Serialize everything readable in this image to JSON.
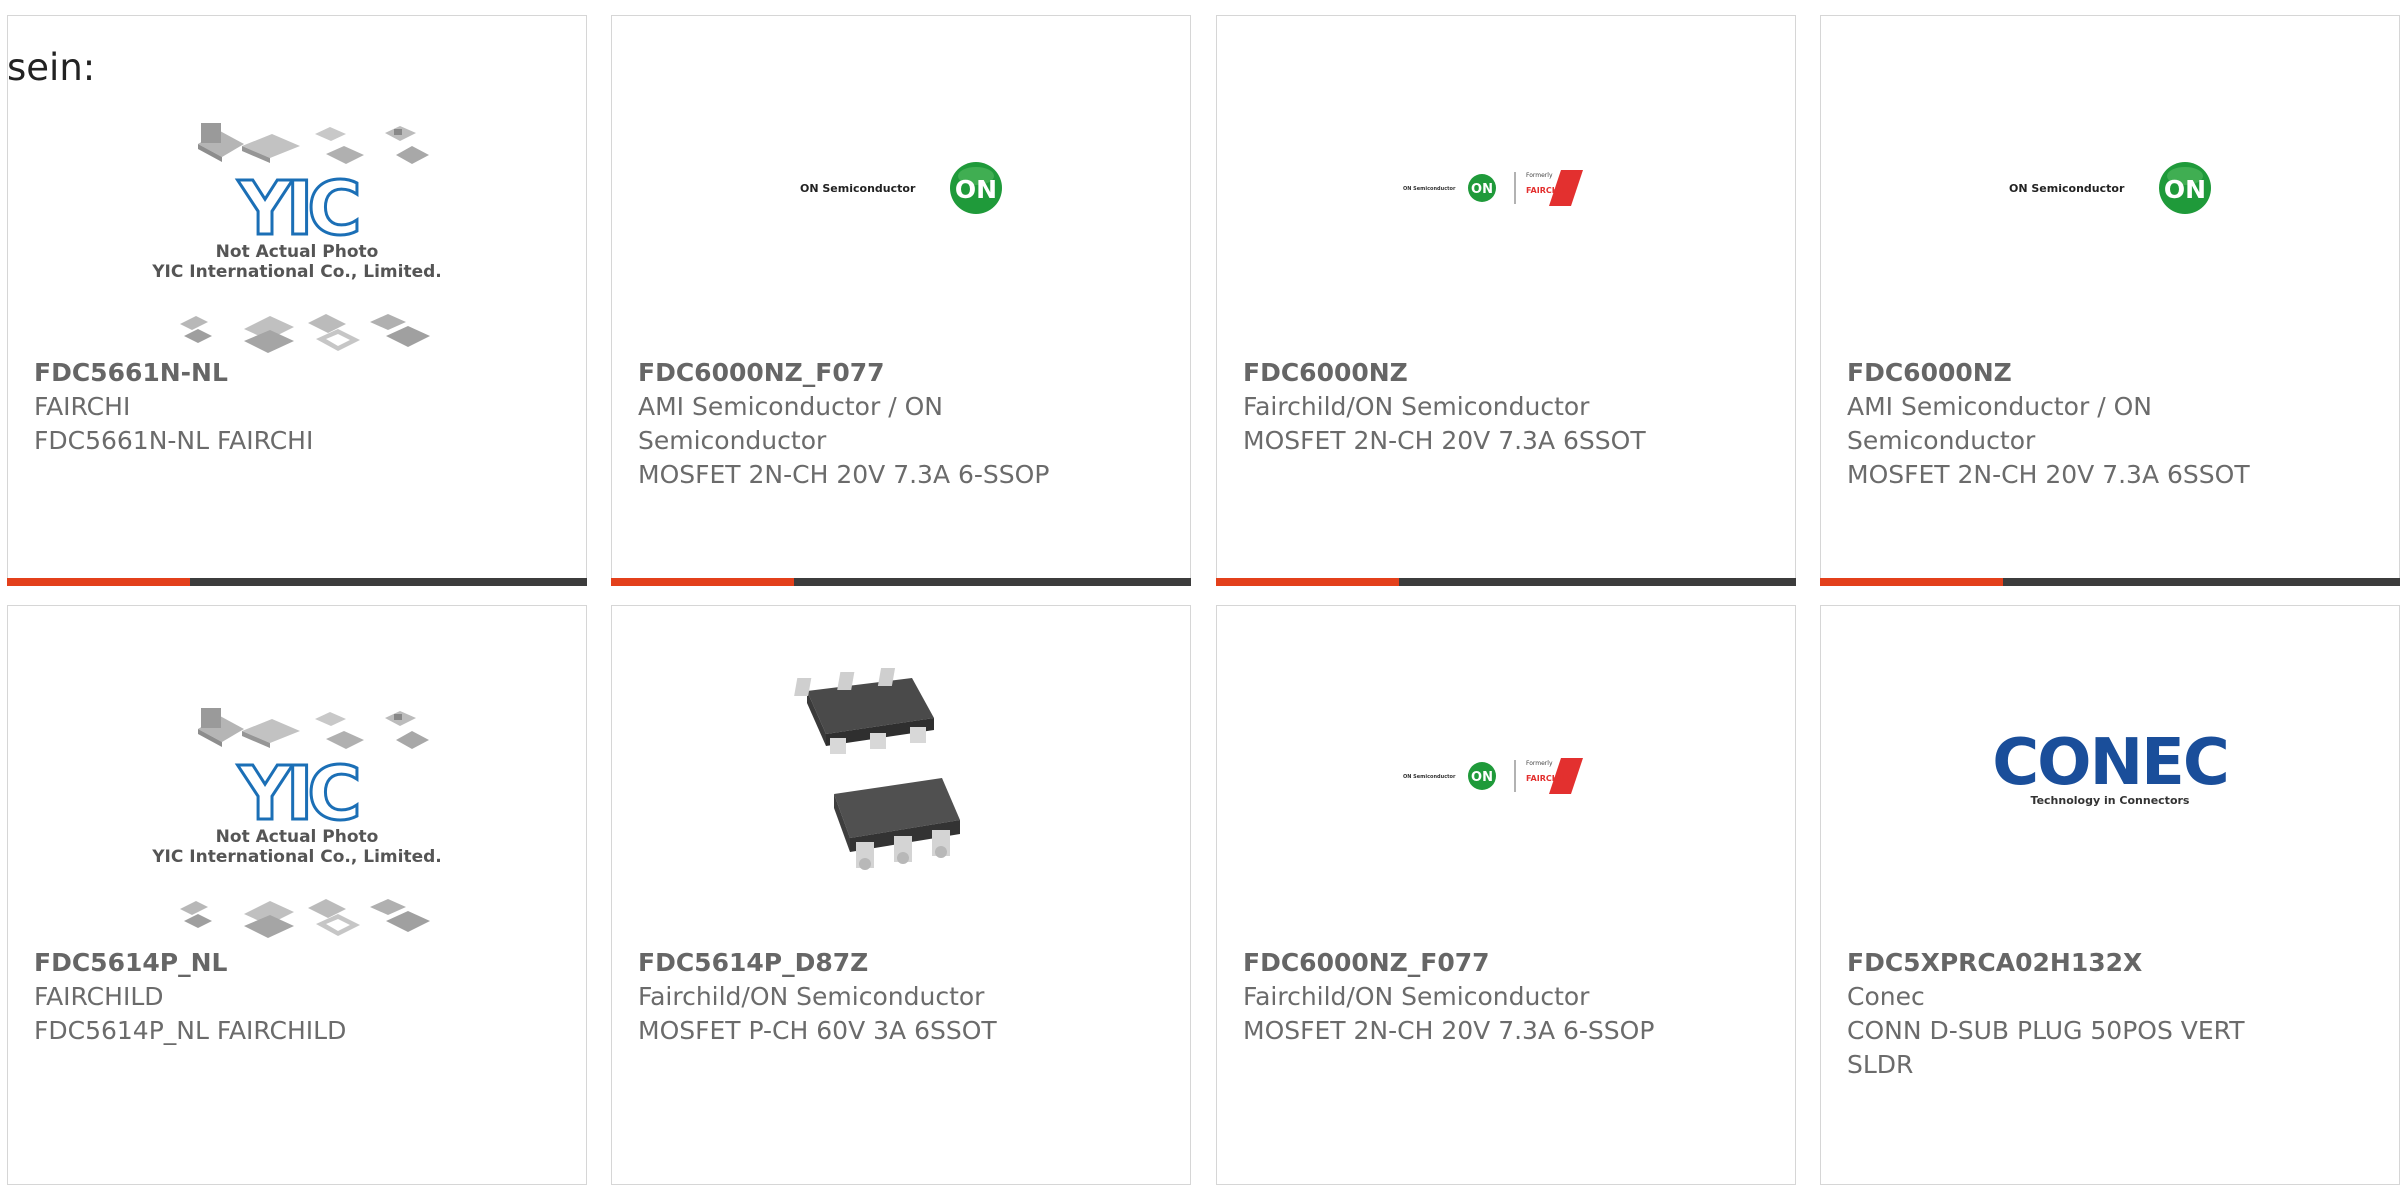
{
  "intro_text": "sein:",
  "colors": {
    "accent": "#e3401b",
    "bar_dark": "#3c3c3c",
    "on_green": "#1f9a3a",
    "conec_blue": "#1a4e9a",
    "fairchild_red": "#e3302f"
  },
  "placeholder_image": {
    "brand": "YIC",
    "line1": "Not Actual Photo",
    "line2": "YIC International Co., Limited."
  },
  "logos": {
    "on_semi": {
      "text": "ON Semiconductor",
      "badge": "ON"
    },
    "fairchild": {
      "formerly": "Formerly",
      "name": "FAIRCHILD."
    },
    "conec": {
      "name": "CONEC",
      "tagline": "Technology in Connectors"
    }
  },
  "products": [
    {
      "part": "FDC5661N-NL",
      "manufacturer": "FAIRCHI",
      "description": "FDC5661N-NL FAIRCHI",
      "image": "yic-placeholder"
    },
    {
      "part": "FDC6000NZ_F077",
      "manufacturer": "AMI Semiconductor / ON Semiconductor",
      "description": "MOSFET 2N-CH 20V 7.3A 6-SSOP",
      "image": "on-semi-logo"
    },
    {
      "part": "FDC6000NZ",
      "manufacturer": "Fairchild/ON Semiconductor",
      "description": "MOSFET 2N-CH 20V 7.3A 6SSOT",
      "image": "on-fairchild-logo"
    },
    {
      "part": "FDC6000NZ",
      "manufacturer": "AMI Semiconductor / ON Semiconductor",
      "description": "MOSFET 2N-CH 20V 7.3A 6SSOT",
      "image": "on-semi-logo"
    },
    {
      "part": "FDC5614P_NL",
      "manufacturer": "FAIRCHILD",
      "description": "FDC5614P_NL FAIRCHILD",
      "image": "yic-placeholder"
    },
    {
      "part": "FDC5614P_D87Z",
      "manufacturer": "Fairchild/ON Semiconductor",
      "description": "MOSFET P-CH 60V 3A 6SSOT",
      "image": "ssot6-package-photo"
    },
    {
      "part": "FDC6000NZ_F077",
      "manufacturer": "Fairchild/ON Semiconductor",
      "description": "MOSFET 2N-CH 20V 7.3A 6-SSOP",
      "image": "on-fairchild-logo"
    },
    {
      "part": "FDC5XPRCA02H132X",
      "manufacturer": "Conec",
      "description": "CONN D-SUB PLUG 50POS VERT SLDR",
      "image": "conec-logo"
    }
  ]
}
